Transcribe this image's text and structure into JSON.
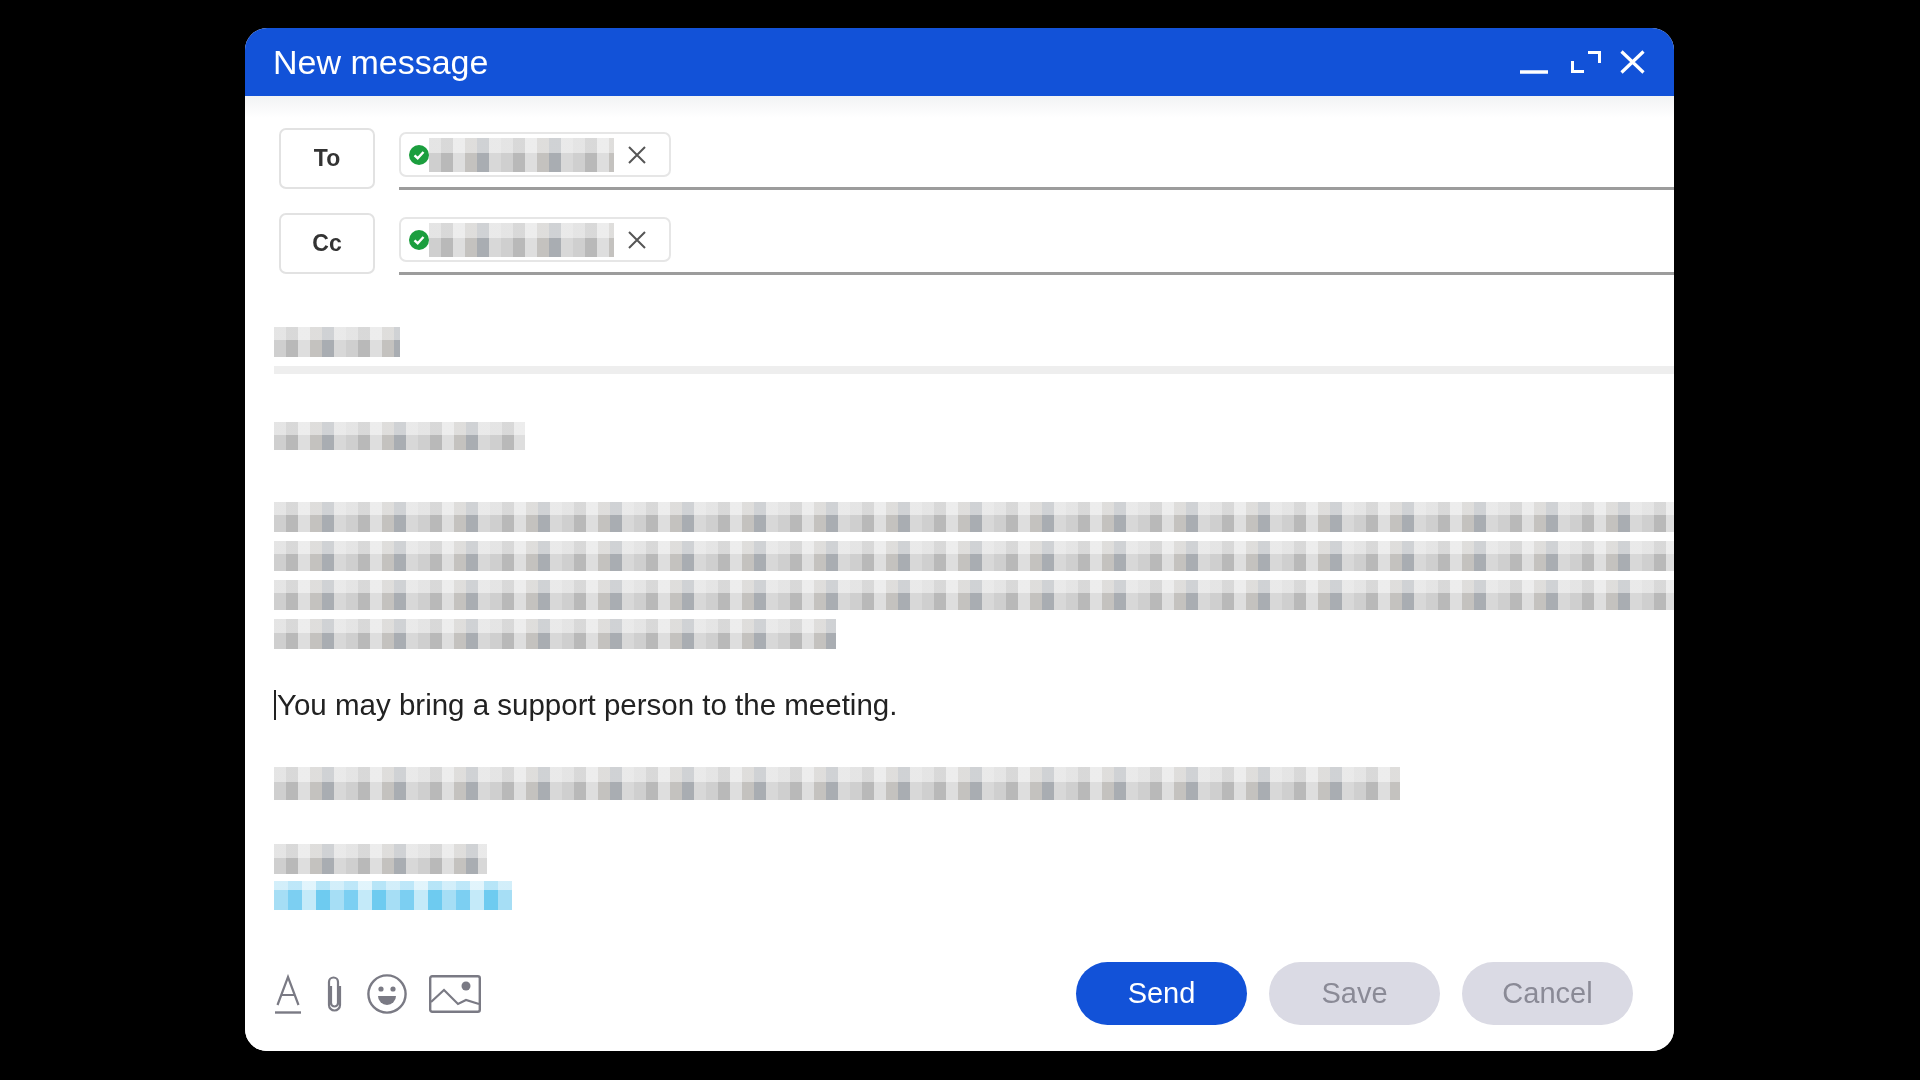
{
  "window": {
    "title": "New message"
  },
  "title_controls": [
    {
      "kind": "minimize"
    },
    {
      "kind": "maximize"
    },
    {
      "kind": "close"
    }
  ],
  "recipients": [
    {
      "label": "To",
      "chips": [
        {
          "verified": true
        }
      ]
    },
    {
      "label": "Cc",
      "chips": [
        {
          "verified": true
        }
      ]
    }
  ],
  "subject": {
    "redacted": true
  },
  "body": [
    {
      "kind": "greeting"
    },
    {
      "kind": "paragraph"
    },
    {
      "kind": "text",
      "text": "You may bring a support person to the meeting.",
      "caret": true
    },
    {
      "kind": "closing"
    },
    {
      "kind": "signature"
    }
  ],
  "toolbar": [
    {
      "kind": "format"
    },
    {
      "kind": "attach"
    },
    {
      "kind": "emoji"
    },
    {
      "kind": "image"
    }
  ],
  "buttons": [
    {
      "label": "Send",
      "kind": "primary"
    },
    {
      "label": "Save",
      "kind": "secondary"
    },
    {
      "label": "Cancel",
      "kind": "secondary"
    }
  ]
}
